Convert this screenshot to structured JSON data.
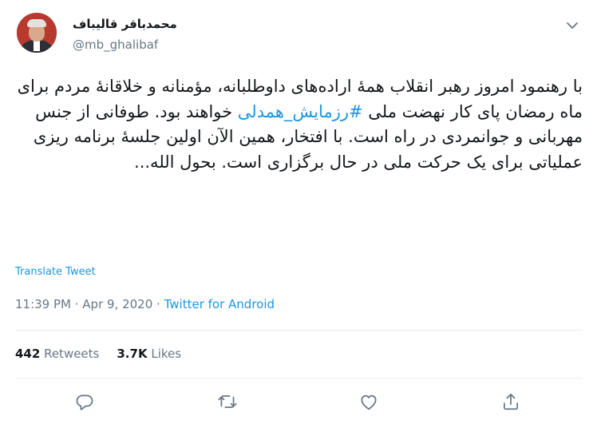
{
  "author": {
    "name": "محمدباقر قالیباف",
    "handle": "@mb_ghalibaf"
  },
  "tweet": {
    "text_before_hashtag": "با رهنمود امروز رهبر انقلاب همهٔ اراده‌های داوطلبانه، مؤمنانه و خلاقانهٔ مردم برای ماه رمضان پای کار نهضت ملی ",
    "hashtag": "#رزمایش_همدلی",
    "text_after_hashtag": " خواهند بود. طوفانی از جنس مهربانی و جوانمردی در راه است. با افتخار، همین الآن اولین جلسهٔ برنامه ریزی عملیاتی برای یک حرکت ملی در حال برگزاری است. بحول الله..."
  },
  "translate_label": "Translate Tweet",
  "meta": {
    "time": "11:39 PM",
    "separator": " · ",
    "date": "Apr 9, 2020",
    "separator2": " · ",
    "source": "Twitter for Android"
  },
  "stats": {
    "retweets_count": "442",
    "retweets_label": " Retweets",
    "likes_count": "3.7K",
    "likes_label": " Likes"
  },
  "icons": {
    "menu": "chevron-down-icon",
    "reply": "reply-icon",
    "retweet": "retweet-icon",
    "like": "heart-icon",
    "share": "share-icon"
  },
  "colors": {
    "link": "#1b95e0",
    "secondary_text": "#657786",
    "primary_text": "#14171a",
    "divider": "#e6ecf0"
  }
}
